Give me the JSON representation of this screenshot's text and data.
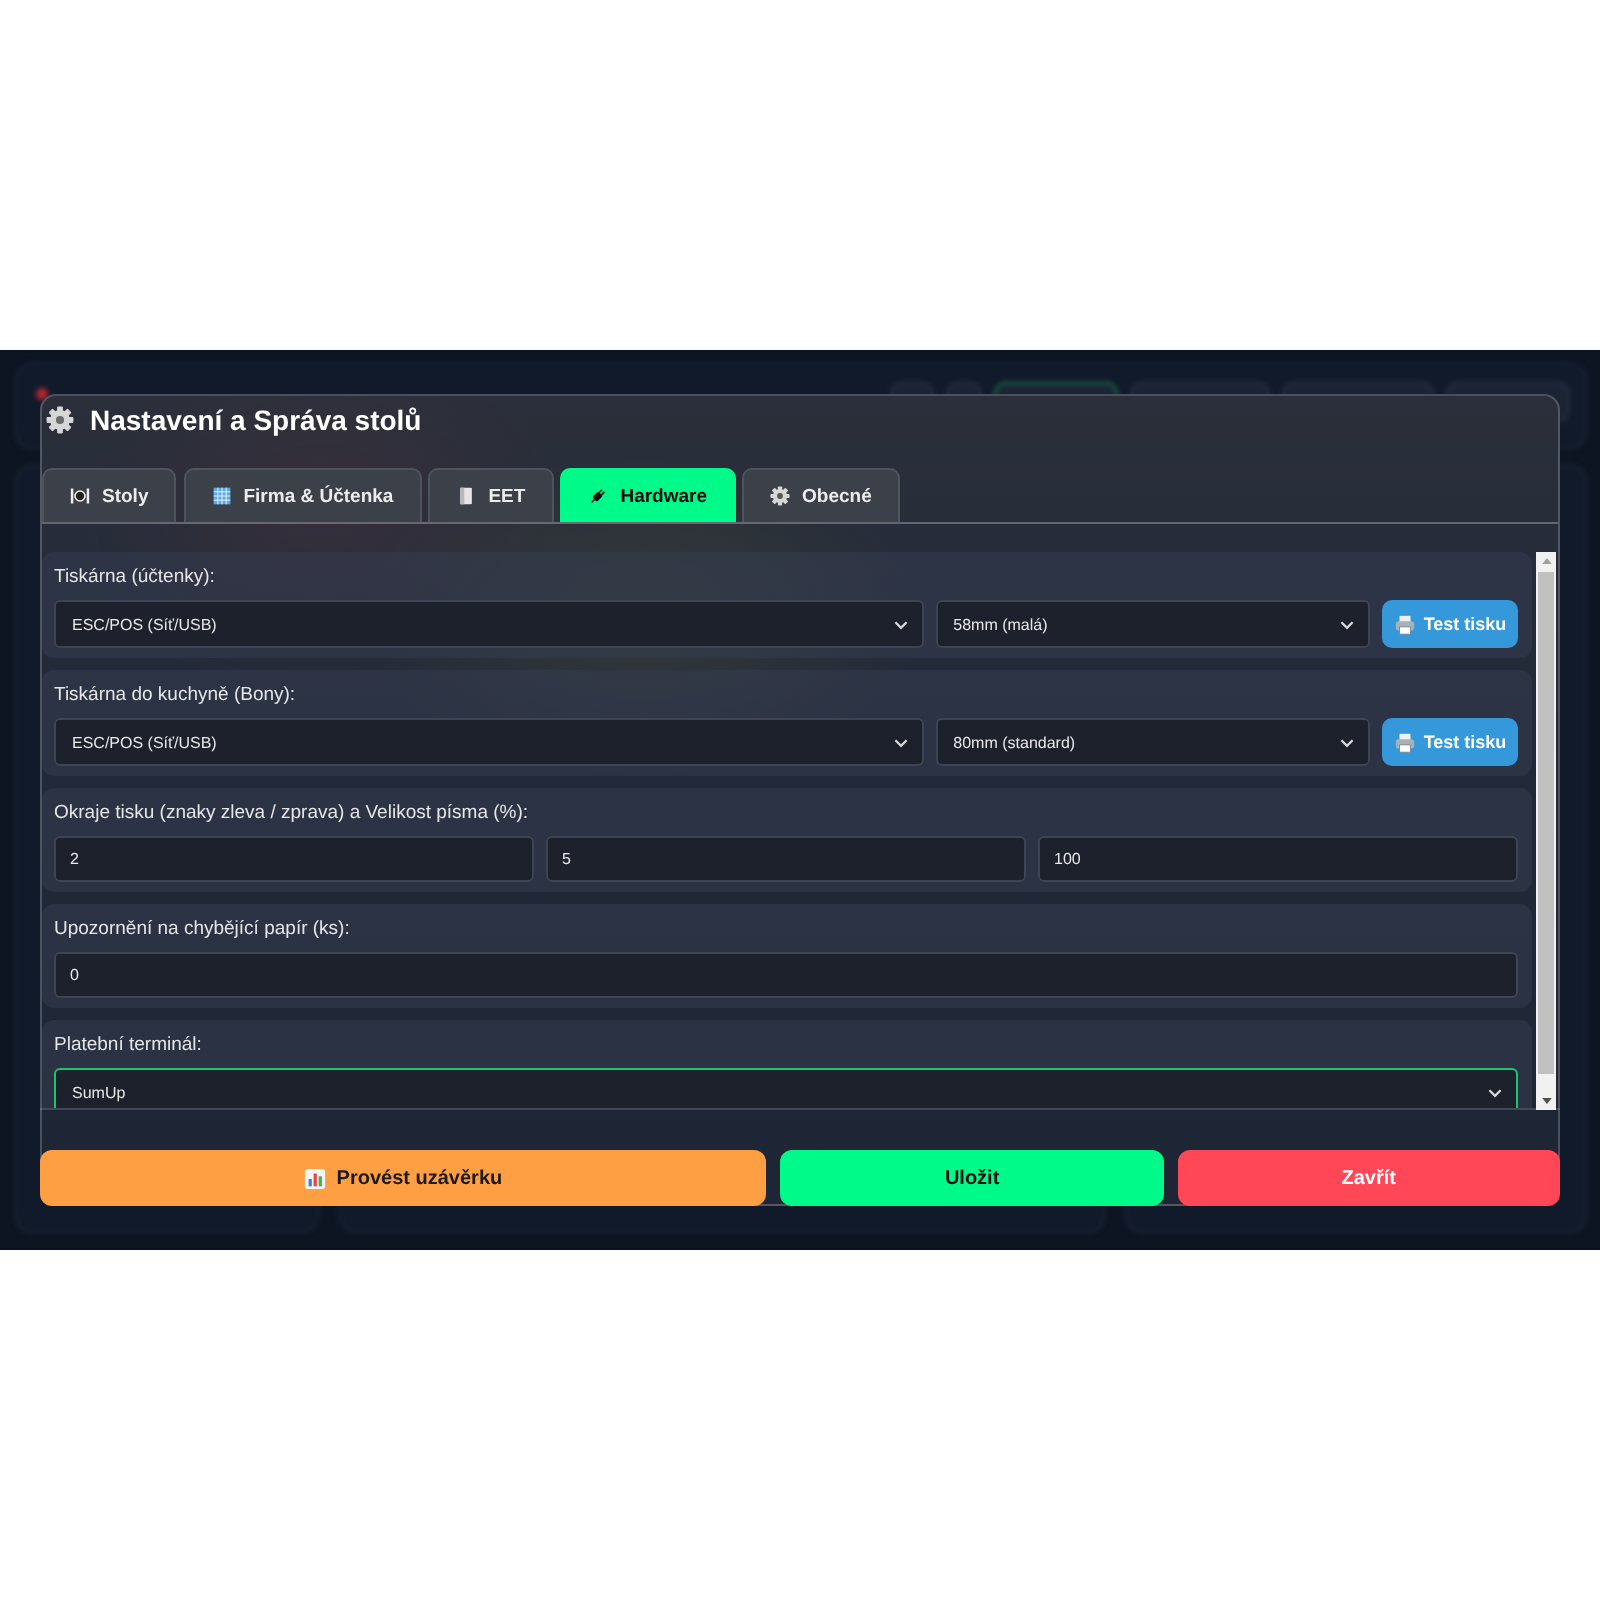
{
  "dialog": {
    "title": "Nastavení a Správa stolů"
  },
  "tabs": [
    {
      "label": "Stoly",
      "selected": false
    },
    {
      "label": "Firma & Účtenka",
      "selected": false
    },
    {
      "label": "EET",
      "selected": false
    },
    {
      "label": "Hardware",
      "selected": true
    },
    {
      "label": "Obecné",
      "selected": false
    }
  ],
  "sections": [
    {
      "label": "Tiskárna (účtenky):",
      "fields": [
        {
          "kind": "select",
          "value": "ESC/POS (Síť/USB)",
          "focused": false
        },
        {
          "kind": "select",
          "value": "58mm (malá)",
          "focused": false
        }
      ],
      "button": {
        "label": "Test tisku"
      }
    },
    {
      "label": "Tiskárna do kuchyně (Bony):",
      "fields": [
        {
          "kind": "select",
          "value": "ESC/POS (Síť/USB)",
          "focused": false
        },
        {
          "kind": "select",
          "value": "80mm (standard)",
          "focused": false
        }
      ],
      "button": {
        "label": "Test tisku"
      }
    },
    {
      "label": "Okraje tisku (znaky zleva / zprava) a Velikost písma (%):",
      "fields": [
        {
          "kind": "input",
          "value": "2",
          "focused": false
        },
        {
          "kind": "input",
          "value": "5",
          "focused": false
        },
        {
          "kind": "input",
          "value": "100",
          "focused": false
        }
      ]
    },
    {
      "label": "Upozornění na chybějící papír (ks):",
      "fields": [
        {
          "kind": "input",
          "value": "0",
          "focused": false
        }
      ]
    },
    {
      "label": "Platební terminál:",
      "fields": [
        {
          "kind": "select",
          "value": "SumUp",
          "focused": true
        }
      ]
    }
  ],
  "footer_buttons": [
    {
      "kind": "closing",
      "label": "Provést uzávěrku"
    },
    {
      "kind": "save",
      "label": "Uložit"
    },
    {
      "kind": "close",
      "label": "Zavřít"
    }
  ]
}
